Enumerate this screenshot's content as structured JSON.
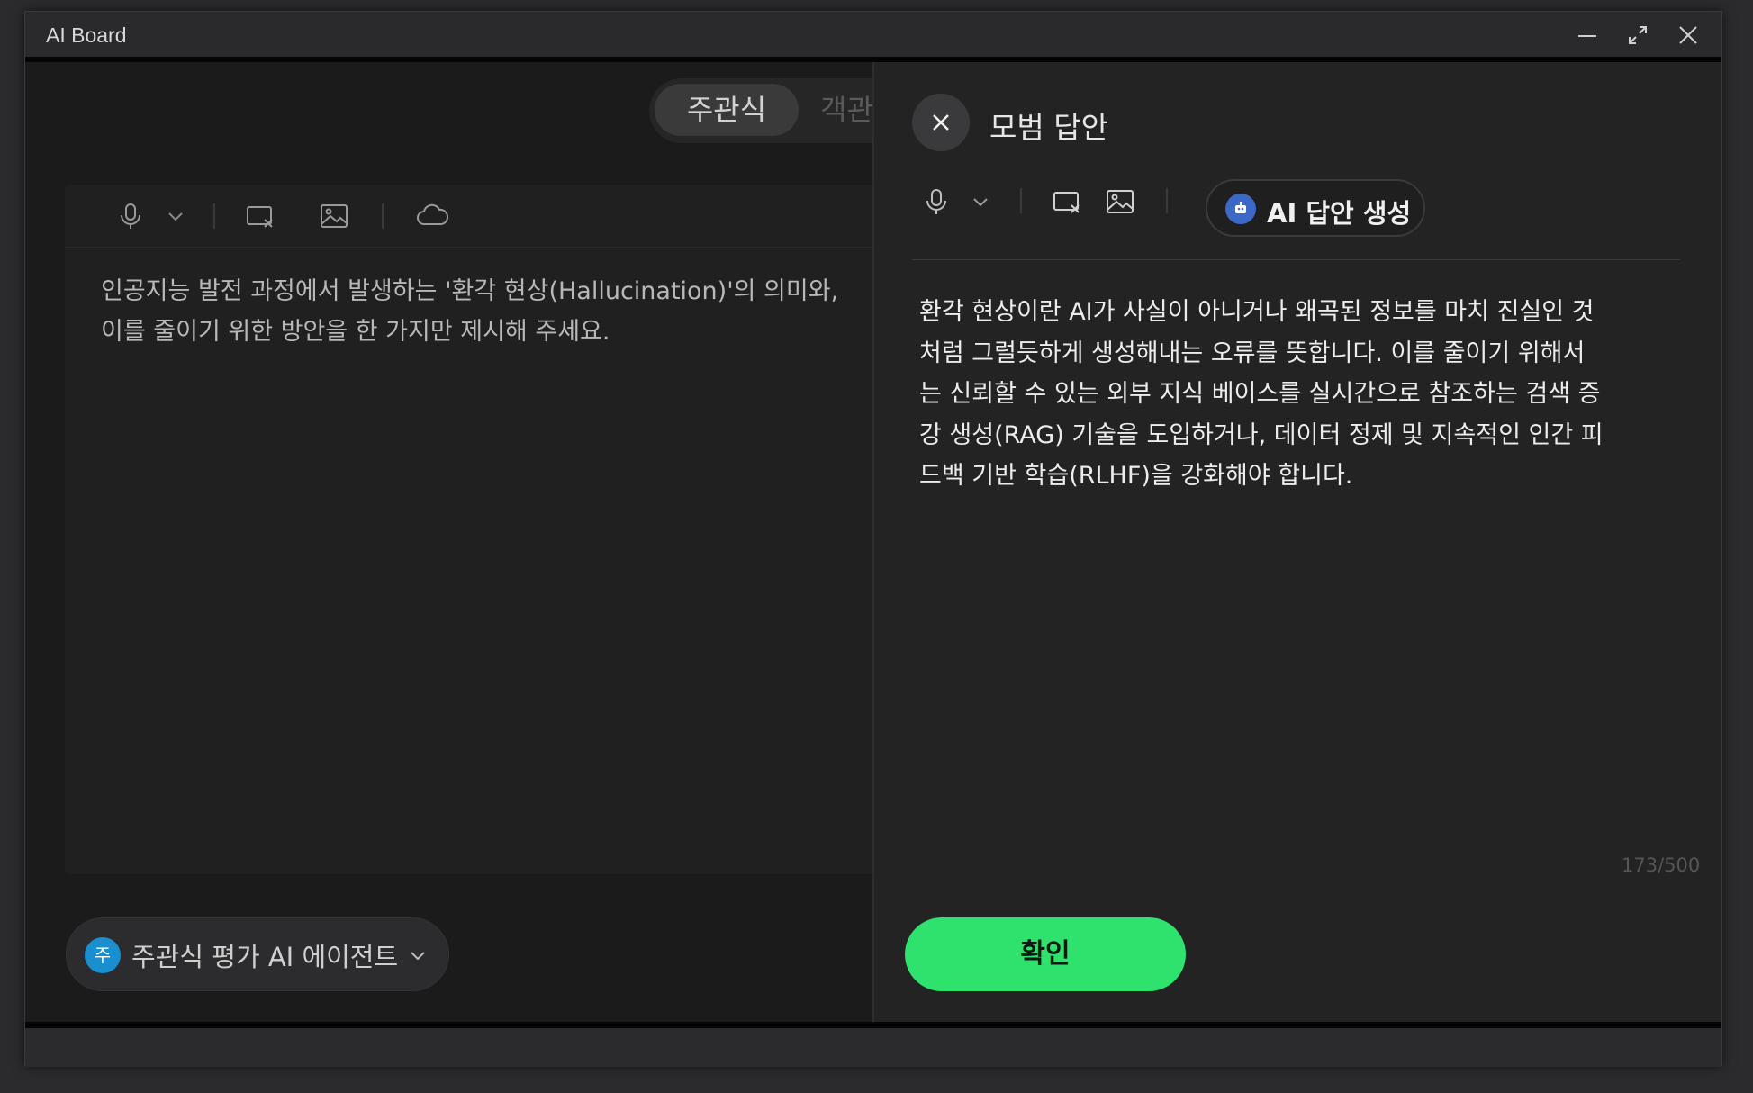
{
  "window": {
    "title": "AI Board"
  },
  "tabs": [
    {
      "label": "주관식",
      "active": true
    },
    {
      "label": "객관"
    }
  ],
  "left_toolbar": {
    "icons": [
      "microphone-icon",
      "chevron-down-icon",
      "screen-capture-icon",
      "image-icon",
      "cloud-icon"
    ]
  },
  "question": {
    "line1": "인공지능 발전 과정에서 발생하는 '환각 현상(Hallucination)'의 의미와,",
    "line2": "이를 줄이기 위한 방안을 한 가지만 제시해 주세요."
  },
  "agent": {
    "avatar": "주",
    "label": "주관식 평가 AI 에이전트"
  },
  "answer_panel": {
    "title": "모범 답안",
    "ai_button_label": "AI 답안 생성",
    "answer_line1": "환각 현상이란 AI가 사실이 아니거나 왜곡된 정보를 마치 진실인 것",
    "answer_line2": "처럼 그럴듯하게 생성해내는 오류를 뜻합니다. 이를 줄이기 위해서",
    "answer_line3": "는 신뢰할 수 있는 외부 지식 베이스를 실시간으로 참조하는 검색 증",
    "answer_line4": "강 생성(RAG) 기술을 도입하거나, 데이터 정제 및 지속적인 인간 피",
    "answer_line5": "드백 기반 학습(RLHF)을 강화해야 합니다.",
    "char_count": "173/500",
    "confirm_label": "확인"
  },
  "colors": {
    "confirm_green": "#2ee26d",
    "agent_blue": "#1a8fd0",
    "ai_icon_blue": "#3c69c8"
  }
}
